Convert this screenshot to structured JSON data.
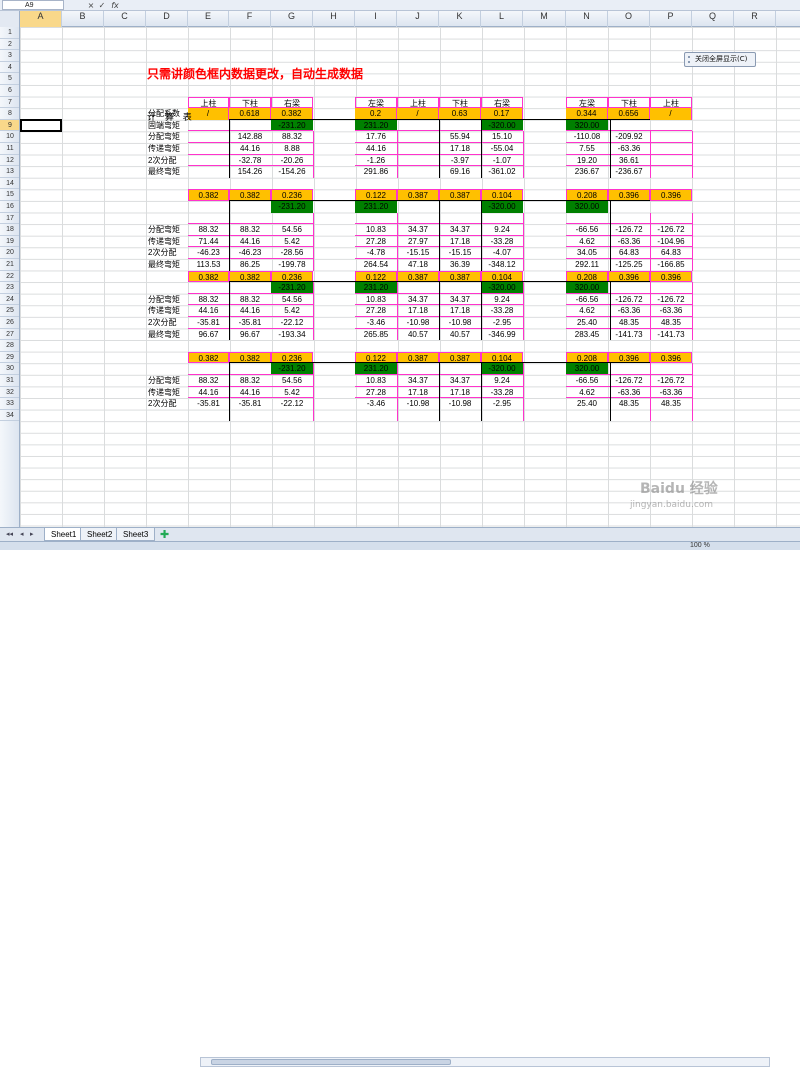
{
  "name_box": "A9",
  "formula_icons": [
    "×",
    "✓",
    "fx"
  ],
  "columns": [
    "A",
    "B",
    "C",
    "D",
    "E",
    "F",
    "G",
    "H",
    "I",
    "J",
    "K",
    "L",
    "M",
    "N",
    "O",
    "P",
    "Q",
    "R"
  ],
  "selected_column": "A",
  "selected_row": "9",
  "rows": [
    "1",
    "2",
    "3",
    "4",
    "5",
    "6",
    "7",
    "8",
    "9",
    "10",
    "11",
    "12",
    "13",
    "14",
    "15",
    "16",
    "17",
    "18",
    "19",
    "20",
    "21",
    "22",
    "23",
    "24",
    "25",
    "26",
    "27",
    "28",
    "29",
    "30",
    "31",
    "32",
    "33",
    "34"
  ],
  "title": "只需讲颜色框内数据更改，自动生成数据",
  "calc_label": "计 算 表",
  "close_full_screen": "关闭全屏显示(C)",
  "header_row": {
    "left": [
      "上柱",
      "下柱",
      "右梁"
    ],
    "mid": [
      "左梁",
      "上柱",
      "下柱",
      "右梁"
    ],
    "right": [
      "左梁",
      "下柱",
      "上柱"
    ]
  },
  "coef_label": "分配系数",
  "coef_row": {
    "left": [
      "/",
      "0.618",
      "0.382"
    ],
    "mid": [
      "0.2",
      "/",
      "0.63",
      "0.17"
    ],
    "right": [
      "0.344",
      "0.656",
      "/"
    ]
  },
  "block1": {
    "fixed_label": "固端弯矩",
    "fixed": {
      "g": "-231.20",
      "i": "231.20",
      "l": "-320.00",
      "n": "320.00"
    },
    "rows": [
      {
        "label": "分配弯矩",
        "v": [
          "",
          "142.88",
          "88.32",
          "17.76",
          "",
          "55.94",
          "15.10",
          "-110.08",
          "-209.92",
          ""
        ]
      },
      {
        "label": "传递弯矩",
        "v": [
          "",
          "44.16",
          "8.88",
          "44.16",
          "",
          "17.18",
          "-55.04",
          "7.55",
          "-63.36",
          ""
        ]
      },
      {
        "label": "2次分配",
        "v": [
          "",
          "-32.78",
          "-20.26",
          "-1.26",
          "",
          "-3.97",
          "-1.07",
          "19.20",
          "36.61",
          ""
        ]
      },
      {
        "label": "最终弯矩",
        "v": [
          "",
          "154.26",
          "-154.26",
          "291.86",
          "",
          "69.16",
          "-361.02",
          "236.67",
          "-236.67",
          ""
        ]
      }
    ]
  },
  "coef2": [
    "0.382",
    "0.382",
    "0.236",
    "0.122",
    "0.387",
    "0.387",
    "0.104",
    "0.208",
    "0.396",
    "0.396"
  ],
  "block2": {
    "fixed": {
      "g": "-231.20",
      "i": "231.20",
      "l": "-320.00",
      "n": "320.00"
    },
    "rows": [
      {
        "label": "分配弯矩",
        "v": [
          "88.32",
          "88.32",
          "54.56",
          "10.83",
          "34.37",
          "34.37",
          "9.24",
          "-66.56",
          "-126.72",
          "-126.72"
        ]
      },
      {
        "label": "传递弯矩",
        "v": [
          "71.44",
          "44.16",
          "5.42",
          "27.28",
          "27.97",
          "17.18",
          "-33.28",
          "4.62",
          "-63.36",
          "-104.96"
        ]
      },
      {
        "label": "2次分配",
        "v": [
          "-46.23",
          "-46.23",
          "-28.56",
          "-4.78",
          "-15.15",
          "-15.15",
          "-4.07",
          "34.05",
          "64.83",
          "64.83"
        ]
      },
      {
        "label": "最终弯矩",
        "v": [
          "113.53",
          "86.25",
          "-199.78",
          "264.54",
          "47.18",
          "36.39",
          "-348.12",
          "292.11",
          "-125.25",
          "-166.85"
        ]
      }
    ]
  },
  "block3": {
    "fixed": {
      "g": "-231.20",
      "i": "231.20",
      "l": "-320.00",
      "n": "320.00"
    },
    "rows": [
      {
        "label": "分配弯矩",
        "v": [
          "88.32",
          "88.32",
          "54.56",
          "10.83",
          "34.37",
          "34.37",
          "9.24",
          "-66.56",
          "-126.72",
          "-126.72"
        ]
      },
      {
        "label": "传递弯矩",
        "v": [
          "44.16",
          "44.16",
          "5.42",
          "27.28",
          "17.18",
          "17.18",
          "-33.28",
          "4.62",
          "-63.36",
          "-63.36"
        ]
      },
      {
        "label": "2次分配",
        "v": [
          "-35.81",
          "-35.81",
          "-22.12",
          "-3.46",
          "-10.98",
          "-10.98",
          "-2.95",
          "25.40",
          "48.35",
          "48.35"
        ]
      },
      {
        "label": "最终弯矩",
        "v": [
          "96.67",
          "96.67",
          "-193.34",
          "265.85",
          "40.57",
          "40.57",
          "-346.99",
          "283.45",
          "-141.73",
          "-141.73"
        ]
      }
    ]
  },
  "block4": {
    "fixed": {
      "g": "-231.20",
      "i": "231.20",
      "l": "-320.00",
      "n": "320.00"
    },
    "rows": [
      {
        "label": "分配弯矩",
        "v": [
          "88.32",
          "88.32",
          "54.56",
          "10.83",
          "34.37",
          "34.37",
          "9.24",
          "-66.56",
          "-126.72",
          "-126.72"
        ]
      },
      {
        "label": "传递弯矩",
        "v": [
          "44.16",
          "44.16",
          "5.42",
          "27.28",
          "17.18",
          "17.18",
          "-33.28",
          "4.62",
          "-63.36",
          "-63.36"
        ]
      },
      {
        "label": "2次分配",
        "v": [
          "-35.81",
          "-35.81",
          "-22.12",
          "-3.46",
          "-10.98",
          "-10.98",
          "-2.95",
          "25.40",
          "48.35",
          "48.35"
        ]
      }
    ]
  },
  "sheets": [
    "Sheet1",
    "Sheet2",
    "Sheet3"
  ],
  "zoom": "100 %",
  "watermark": "Baidu 经验",
  "watermark_url": "jingyan.baidu.com"
}
